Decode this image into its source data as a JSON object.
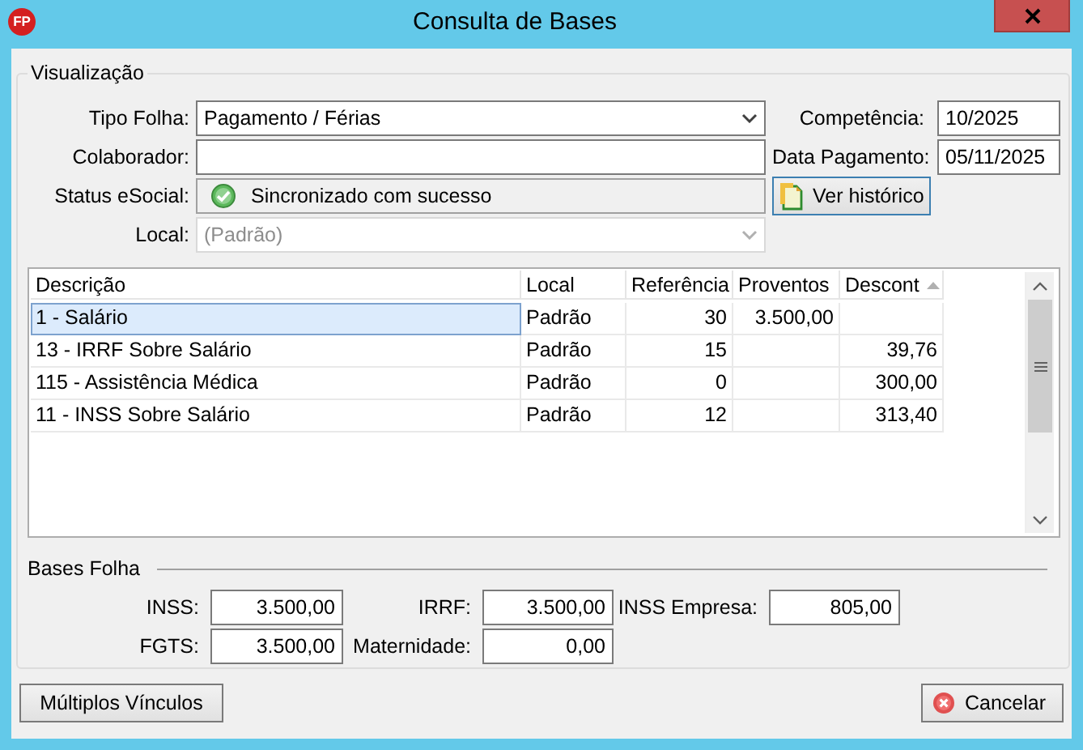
{
  "window": {
    "title": "Consulta de Bases",
    "icon_text": "FP"
  },
  "visualizacao": {
    "title": "Visualização",
    "fields": [
      {
        "kind": "combo",
        "label": "Tipo Folha:",
        "value": "Pagamento / Férias",
        "disabled": false
      },
      {
        "kind": "text",
        "label": "Colaborador:"
      },
      {
        "kind": "status",
        "label": "Status eSocial:",
        "value": "Sincronizado com sucesso"
      },
      {
        "kind": "combo",
        "label": "Local:",
        "value": "(Padrão)",
        "disabled": true
      }
    ],
    "right_fields": [
      {
        "label": "Competência:",
        "value": "10/2025"
      },
      {
        "label": "Data Pagamento:",
        "value": "05/11/2025"
      }
    ],
    "history_button": "Ver histórico"
  },
  "table": {
    "columns": [
      {
        "label": "Descrição"
      },
      {
        "label": "Local"
      },
      {
        "label": "Referência"
      },
      {
        "label": "Proventos"
      },
      {
        "label": "Descont",
        "sorted": true
      }
    ],
    "rows": [
      {
        "selected": true,
        "cells": [
          "1 - Salário",
          "Padrão",
          "30",
          "3.500,00",
          null
        ]
      },
      {
        "selected": false,
        "cells": [
          "13 - IRRF Sobre Salário",
          "Padrão",
          "15",
          null,
          "39,76"
        ]
      },
      {
        "selected": false,
        "cells": [
          "115 - Assistência Médica",
          "Padrão",
          "0",
          null,
          "300,00"
        ]
      },
      {
        "selected": false,
        "cells": [
          "11 - INSS Sobre Salário",
          "Padrão",
          "12",
          null,
          "313,40"
        ]
      }
    ]
  },
  "bases": {
    "title": "Bases Folha",
    "fields": [
      {
        "label": "INSS:",
        "value": "3.500,00"
      },
      {
        "label": "IRRF:",
        "value": "3.500,00"
      },
      {
        "label": "INSS Empresa:",
        "value": "805,00"
      },
      {
        "label": "FGTS:",
        "value": "3.500,00"
      },
      {
        "label": "Maternidade:",
        "value": "0,00"
      }
    ]
  },
  "buttons": [
    {
      "kind": "plain",
      "label": "Múltiplos Vínculos"
    },
    {
      "kind": "cancel",
      "label": "Cancelar"
    }
  ]
}
